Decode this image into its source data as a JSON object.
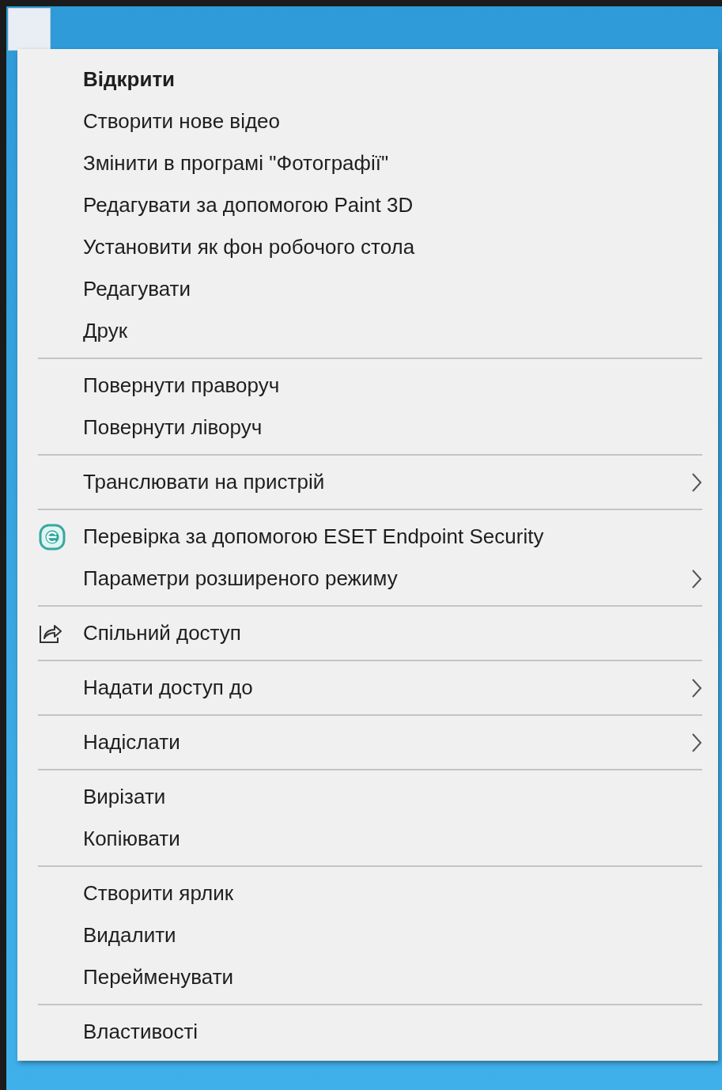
{
  "menu": {
    "groups": [
      {
        "items": [
          {
            "label": "Відкрити",
            "default": true,
            "kind": "plain",
            "submenu": false
          },
          {
            "label": "Створити нове відео",
            "default": false,
            "kind": "plain",
            "submenu": false
          },
          {
            "label": "Змінити в програмі \"Фотографії\"",
            "default": false,
            "kind": "plain",
            "submenu": false
          },
          {
            "label": "Редагувати за допомогою Paint 3D",
            "default": false,
            "kind": "plain",
            "submenu": false
          },
          {
            "label": "Установити як фон робочого стола",
            "default": false,
            "kind": "plain",
            "submenu": false
          },
          {
            "label": "Редагувати",
            "default": false,
            "kind": "plain",
            "submenu": false
          },
          {
            "label": "Друк",
            "default": false,
            "kind": "plain",
            "submenu": false
          }
        ]
      },
      {
        "items": [
          {
            "label": "Повернути праворуч",
            "default": false,
            "kind": "plain",
            "submenu": false
          },
          {
            "label": "Повернути ліворуч",
            "default": false,
            "kind": "plain",
            "submenu": false
          }
        ]
      },
      {
        "items": [
          {
            "label": "Транслювати на пристрій",
            "default": false,
            "kind": "plain",
            "submenu": true
          }
        ]
      },
      {
        "items": [
          {
            "label": "Перевірка за допомогою ESET Endpoint Security",
            "default": false,
            "kind": "eset",
            "submenu": false
          },
          {
            "label": "Параметри розширеного режиму",
            "default": false,
            "kind": "plain",
            "submenu": true
          }
        ]
      },
      {
        "items": [
          {
            "label": "Спільний доступ",
            "default": false,
            "kind": "share",
            "submenu": false
          }
        ]
      },
      {
        "items": [
          {
            "label": "Надати доступ до",
            "default": false,
            "kind": "plain",
            "submenu": true
          }
        ]
      },
      {
        "items": [
          {
            "label": "Надіслати",
            "default": false,
            "kind": "plain",
            "submenu": true
          }
        ]
      },
      {
        "items": [
          {
            "label": "Вирізати",
            "default": false,
            "kind": "plain",
            "submenu": false
          },
          {
            "label": "Копіювати",
            "default": false,
            "kind": "plain",
            "submenu": false
          }
        ]
      },
      {
        "items": [
          {
            "label": "Створити ярлик",
            "default": false,
            "kind": "plain",
            "submenu": false
          },
          {
            "label": "Видалити",
            "default": false,
            "kind": "plain",
            "submenu": false
          },
          {
            "label": "Перейменувати",
            "default": false,
            "kind": "plain",
            "submenu": false
          }
        ]
      },
      {
        "items": [
          {
            "label": "Властивості",
            "default": false,
            "kind": "plain",
            "submenu": false
          }
        ]
      }
    ]
  }
}
